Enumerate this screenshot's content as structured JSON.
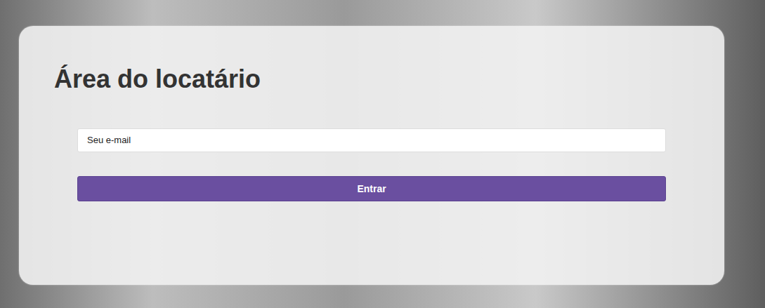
{
  "heading": "Área do locatário",
  "email": {
    "placeholder": "Seu e-mail"
  },
  "button": {
    "label": "Entrar"
  }
}
